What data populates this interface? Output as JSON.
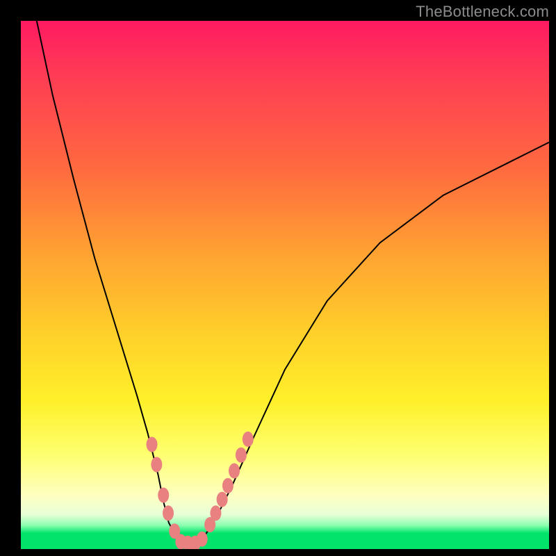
{
  "watermark": "TheBottleneck.com",
  "colors": {
    "frame": "#000000",
    "curve_stroke": "#000000",
    "bead_fill": "#e8817f",
    "gradient_stops": [
      "#ff1a62",
      "#ff3b55",
      "#ff6a3f",
      "#ffa531",
      "#ffd22a",
      "#fff02a",
      "#feff6f",
      "#fdffc2",
      "#e8ffd7",
      "#8cffb0",
      "#00e46a"
    ]
  },
  "chart_data": {
    "type": "line",
    "title": "",
    "xlabel": "",
    "ylabel": "",
    "xlim": [
      0,
      100
    ],
    "ylim": [
      0,
      100
    ],
    "legend": false,
    "grid": false,
    "series": [
      {
        "name": "bottleneck-curve",
        "x": [
          3,
          6,
          10,
          14,
          18,
          22,
          24,
          26,
          27,
          28,
          29.5,
          31,
          33,
          35,
          37,
          40,
          44,
          50,
          58,
          68,
          80,
          92,
          100
        ],
        "y": [
          100,
          86,
          70,
          55,
          42,
          29,
          22,
          14,
          9,
          5,
          2.2,
          1.2,
          1.2,
          2.8,
          6,
          12,
          21,
          34,
          47,
          58,
          67,
          73,
          77
        ]
      }
    ],
    "markers": [
      {
        "name": "beads-left",
        "x": [
          24.8,
          25.7,
          27.0,
          27.9,
          29.1
        ],
        "y": [
          19.8,
          16.0,
          10.2,
          6.8,
          3.4
        ]
      },
      {
        "name": "beads-bottom",
        "x": [
          30.3,
          31.6,
          33.0,
          34.3
        ],
        "y": [
          1.4,
          1.1,
          1.1,
          1.9
        ]
      },
      {
        "name": "beads-right",
        "x": [
          35.8,
          36.9,
          38.1,
          39.2,
          40.4,
          41.7,
          43.0
        ],
        "y": [
          4.6,
          6.8,
          9.4,
          12.0,
          14.8,
          17.8,
          20.8
        ]
      }
    ]
  }
}
